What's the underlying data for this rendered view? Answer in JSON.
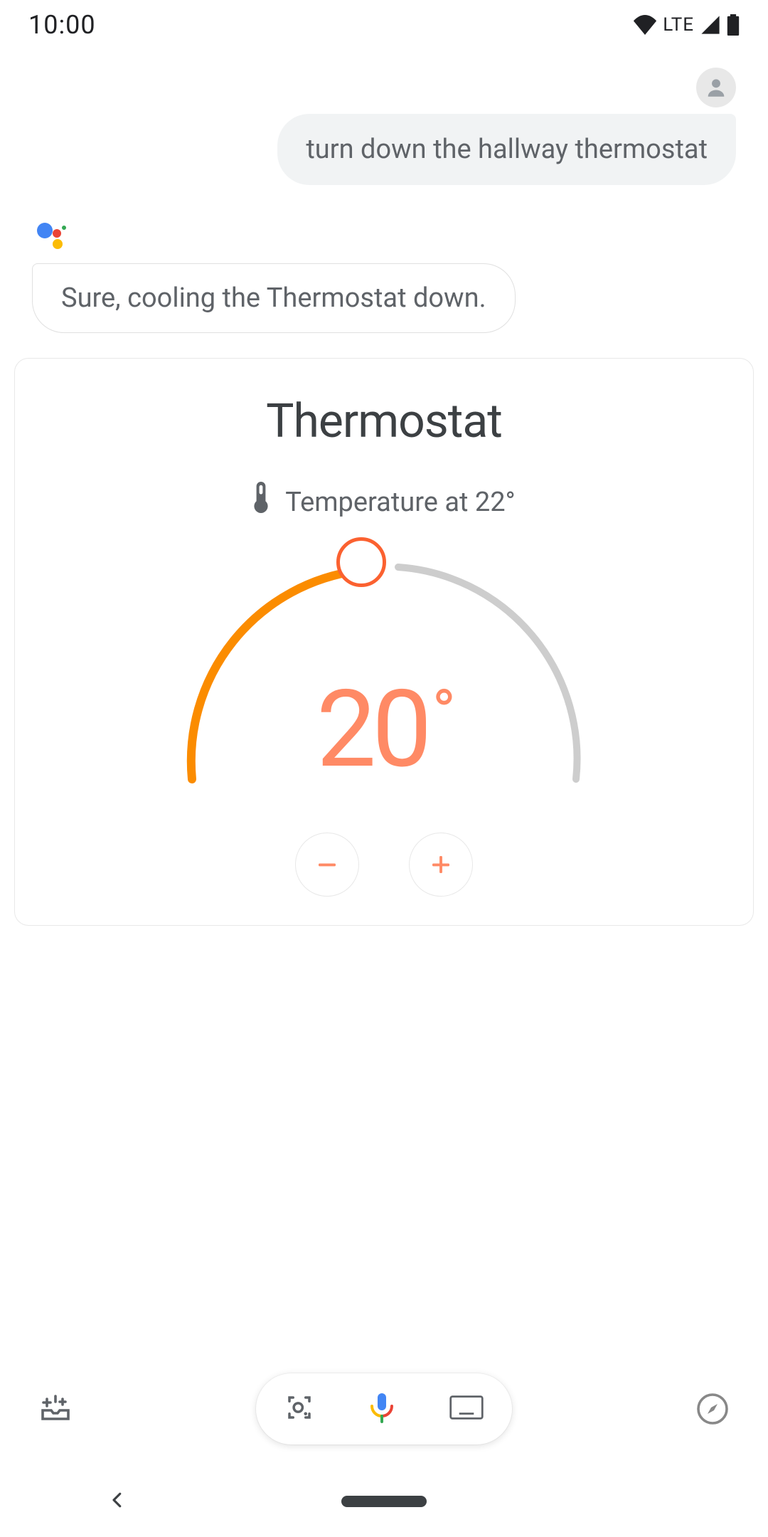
{
  "status": {
    "time": "10:00",
    "network": "LTE"
  },
  "conversation": {
    "user_text": "turn down the hallway thermostat",
    "assistant_text": "Sure, cooling the Thermostat down."
  },
  "thermostat": {
    "title": "Thermostat",
    "status_label": "Temperature at 22°",
    "setpoint_value": "20",
    "setpoint_unit": "°",
    "colors": {
      "accent": "#ff8a65",
      "arc_active": "#fb8c00",
      "arc_inactive": "#c9c9c9"
    }
  }
}
